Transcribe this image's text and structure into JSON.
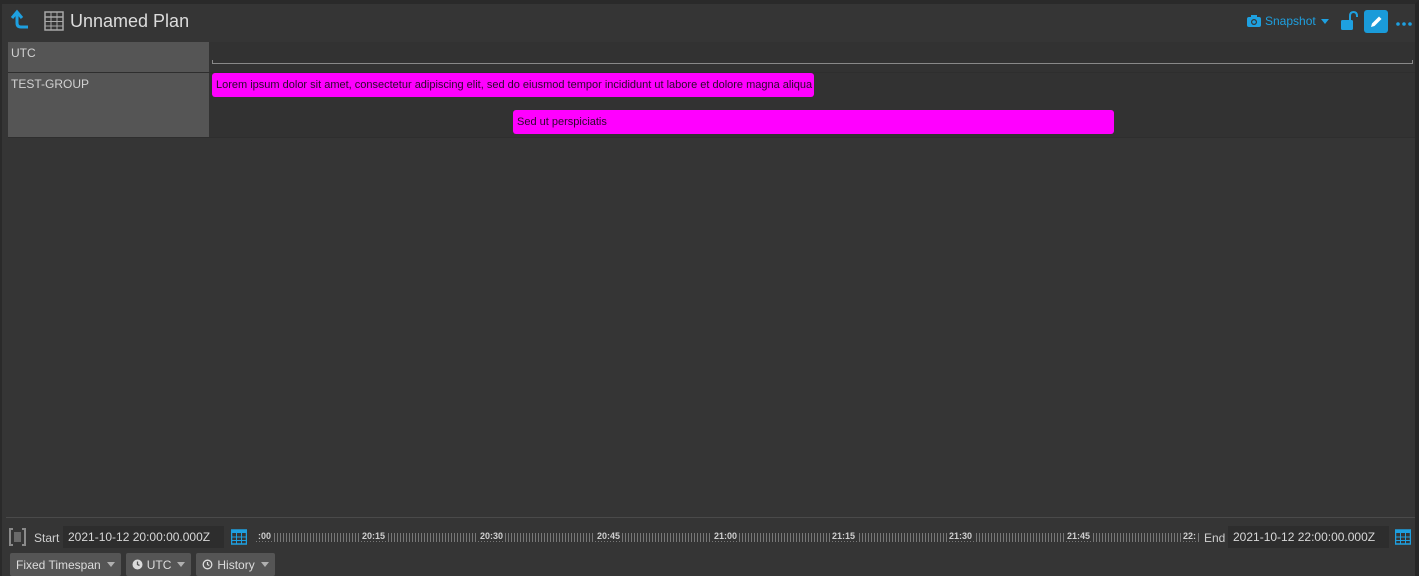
{
  "header": {
    "title": "Unnamed Plan",
    "snapshot_label": "Snapshot",
    "icons": [
      "arrow-up-icon",
      "table-icon",
      "camera-icon",
      "unlock-icon",
      "pencil-icon",
      "ellipsis-icon"
    ]
  },
  "rows": [
    {
      "label": "UTC"
    },
    {
      "label": "TEST-GROUP"
    }
  ],
  "activities": [
    {
      "label": "Lorem ipsum dolor sit amet, consectetur adipiscing elit, sed do eiusmod tempor incididunt ut labore et dolore magna aliqua",
      "color": "#ff00ff"
    },
    {
      "label": "Sed ut perspiciatis",
      "color": "#ff00ff"
    }
  ],
  "conductor": {
    "start_label": "Start",
    "start_value": "2021-10-12 20:00:00.000Z",
    "end_label": "End",
    "end_value": "2021-10-12 22:00:00.000Z",
    "ticks": [
      ":00",
      "20:15",
      "20:30",
      "20:45",
      "21:00",
      "21:15",
      "21:30",
      "21:45",
      "22:"
    ]
  },
  "modes": {
    "timespan": "Fixed Timespan",
    "timezone": "UTC",
    "history": "History"
  },
  "colors": {
    "accent": "#1ea0e0",
    "activity": "#ff00ff",
    "background": "#353535"
  }
}
